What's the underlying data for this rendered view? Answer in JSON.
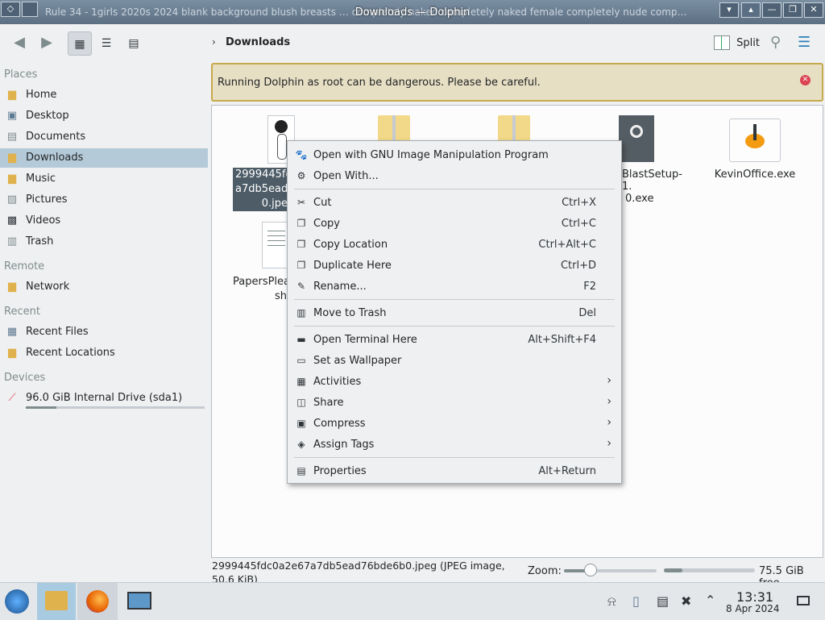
{
  "window": {
    "title": "Downloads — Dolphin",
    "background_title": "Rule 34 - 1girls 2020s 2024 blank background blush breasts … completely naked completely naked female completely nude comp…",
    "controls": [
      "▾",
      "▴",
      "—",
      "❐",
      "✕"
    ]
  },
  "toolbar": {
    "breadcrumb": "Downloads",
    "split_label": "Split"
  },
  "sidebar": {
    "sections": {
      "places": "Places",
      "remote": "Remote",
      "recent": "Recent",
      "devices": "Devices"
    },
    "places": [
      "Home",
      "Desktop",
      "Documents",
      "Downloads",
      "Music",
      "Pictures",
      "Videos",
      "Trash"
    ],
    "remote": [
      "Network"
    ],
    "recent": [
      "Recent Files",
      "Recent Locations"
    ],
    "devices": [
      "96.0 GiB Internal Drive (sda1)"
    ],
    "drive_usage_fraction": 0.17
  },
  "banner": {
    "message": "Running Dolphin as root can be dangerous. Please be careful."
  },
  "files": {
    "jpeg_line1": "2999445fd",
    "jpeg_line2": "a7db5ead7",
    "jpeg_line3": "0.jpe",
    "setup_line1": "BlastSetup-1.",
    "setup_line2": "0.exe",
    "kevin": "KevinOffice.exe",
    "papers_line1": "PapersPlea",
    "papers_line2": "sh"
  },
  "menu": {
    "items": [
      {
        "label": "Open with GNU Image Manipulation Program",
        "shortcut": "",
        "submenu": false,
        "icon": "gimp-icon"
      },
      {
        "label": "Open With...",
        "shortcut": "",
        "submenu": false,
        "icon": "open-with-icon"
      },
      {
        "label": "Cut",
        "shortcut": "Ctrl+X",
        "submenu": false,
        "icon": "scissors-icon"
      },
      {
        "label": "Copy",
        "shortcut": "Ctrl+C",
        "submenu": false,
        "icon": "copy-icon"
      },
      {
        "label": "Copy Location",
        "shortcut": "Ctrl+Alt+C",
        "submenu": false,
        "icon": "copy-location-icon"
      },
      {
        "label": "Duplicate Here",
        "shortcut": "Ctrl+D",
        "submenu": false,
        "icon": "duplicate-icon"
      },
      {
        "label": "Rename...",
        "shortcut": "F2",
        "submenu": false,
        "icon": "rename-icon"
      },
      {
        "label": "Move to Trash",
        "shortcut": "Del",
        "submenu": false,
        "icon": "trash-icon"
      },
      {
        "label": "Open Terminal Here",
        "shortcut": "Alt+Shift+F4",
        "submenu": false,
        "icon": "terminal-icon"
      },
      {
        "label": "Set as Wallpaper",
        "shortcut": "",
        "submenu": false,
        "icon": "wallpaper-icon"
      },
      {
        "label": "Activities",
        "shortcut": "",
        "submenu": true,
        "icon": "activities-icon"
      },
      {
        "label": "Share",
        "shortcut": "",
        "submenu": true,
        "icon": "share-icon"
      },
      {
        "label": "Compress",
        "shortcut": "",
        "submenu": true,
        "icon": "compress-icon"
      },
      {
        "label": "Assign Tags",
        "shortcut": "",
        "submenu": true,
        "icon": "tag-icon"
      },
      {
        "label": "Properties",
        "shortcut": "Alt+Return",
        "submenu": false,
        "icon": "properties-icon"
      }
    ]
  },
  "status": {
    "selection": "2999445fdc0a2e67a7db5ead76bde6b0.jpeg (JPEG image, 50.6 KiB)",
    "zoom_label": "Zoom:",
    "zoom_fraction": 0.29,
    "free_fraction": 0.2,
    "free_space": "75.5 GiB free"
  },
  "taskbar": {
    "time": "13:31",
    "date": "8 Apr 2024"
  },
  "colors": {
    "selection": "#b5cad9",
    "banner_bg": "#e7dfc4",
    "banner_border": "#c7a84b",
    "accent": "#3daee9",
    "close": "#da4453"
  }
}
